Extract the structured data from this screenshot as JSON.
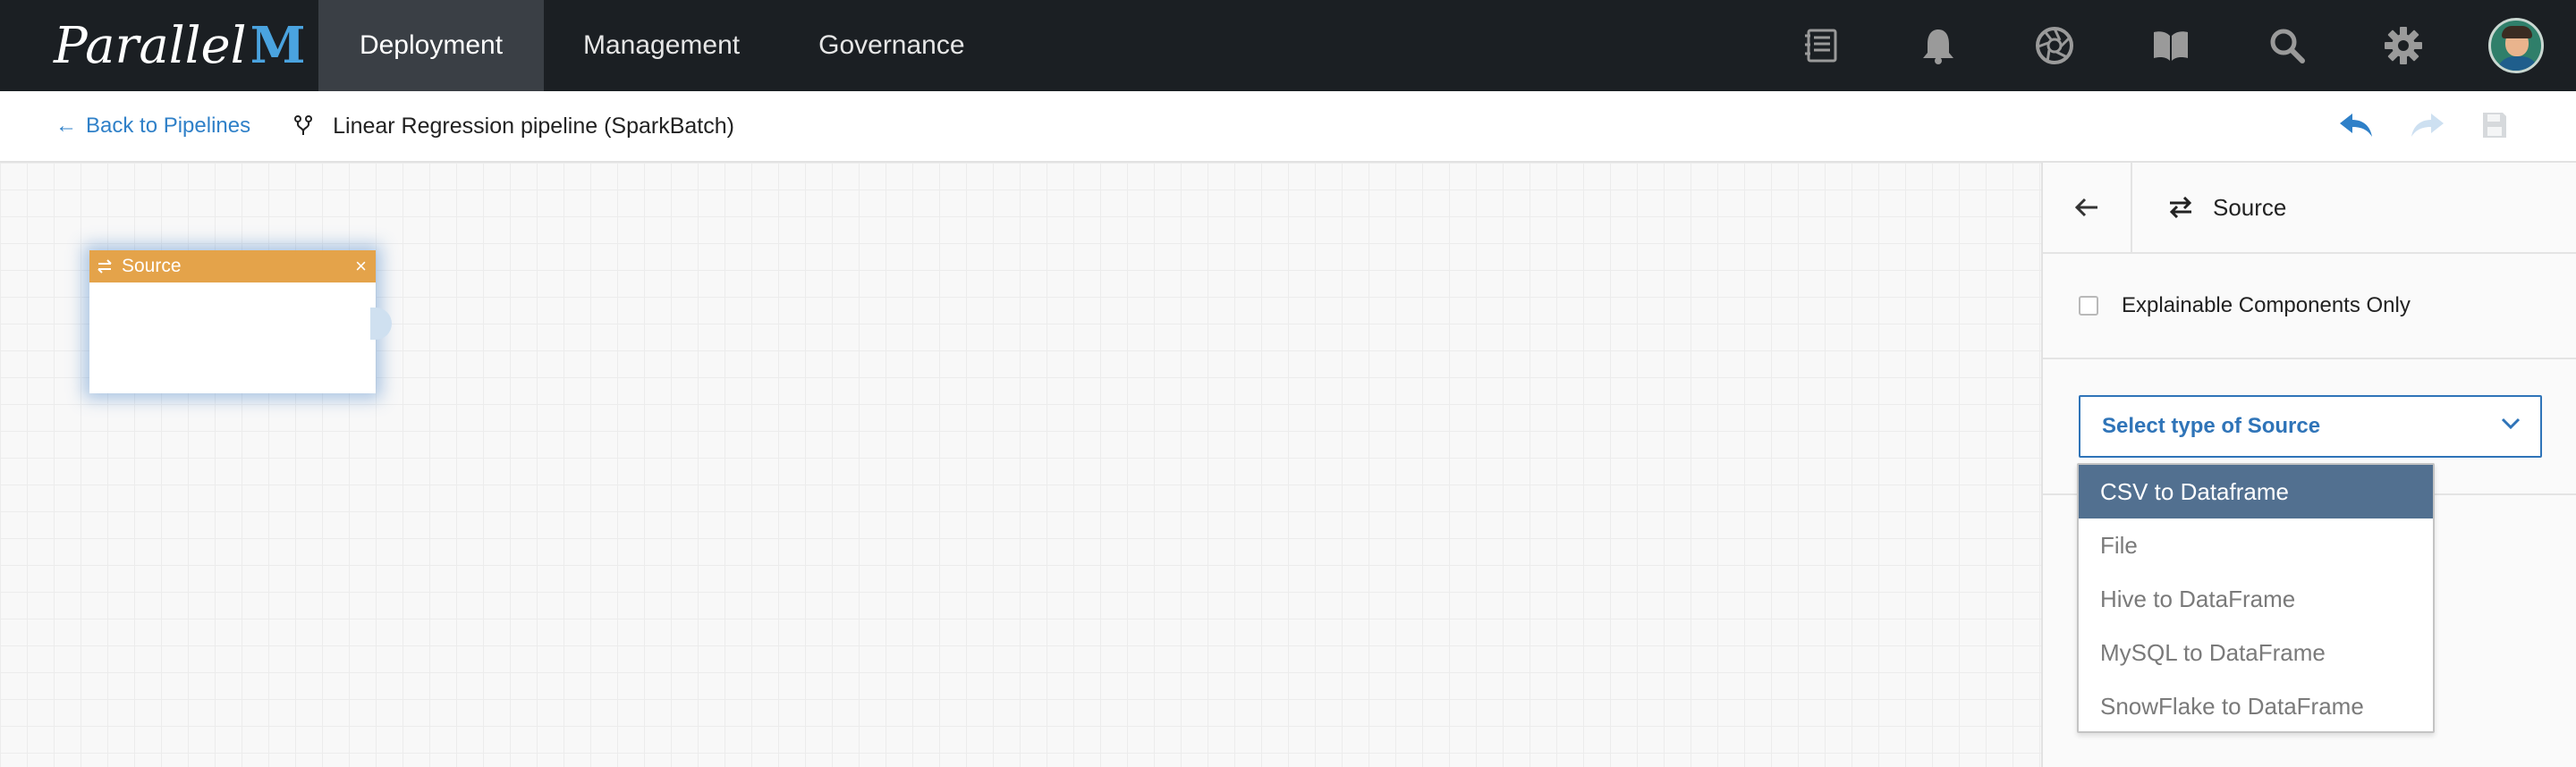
{
  "topbar": {
    "logo_text": "Parallel",
    "logo_accent": "M",
    "tabs": [
      {
        "label": "Deployment",
        "active": true
      },
      {
        "label": "Management",
        "active": false
      },
      {
        "label": "Governance",
        "active": false
      }
    ],
    "icons": [
      "notebook-icon",
      "bell-icon",
      "aperture-icon",
      "book-icon",
      "search-icon",
      "gear-icon",
      "user-avatar"
    ]
  },
  "subheader": {
    "back_label": "Back to Pipelines",
    "pipeline_title": "Linear Regression pipeline (SparkBatch)",
    "actions": [
      "undo-icon",
      "redo-icon",
      "save-icon"
    ]
  },
  "canvas": {
    "node": {
      "title": "Source",
      "icon": "swap-icon",
      "close": "×",
      "header_color": "#e4a34a"
    }
  },
  "panel": {
    "back_icon": "arrow-left-icon",
    "title": "Source",
    "explainable_label": "Explainable Components Only",
    "explainable_checked": false,
    "select_placeholder": "Select type of Source",
    "options": [
      {
        "label": "CSV to Dataframe",
        "selected": true
      },
      {
        "label": "File",
        "selected": false
      },
      {
        "label": "Hive to DataFrame",
        "selected": false
      },
      {
        "label": "MySQL to DataFrame",
        "selected": false
      },
      {
        "label": "SnowFlake to DataFrame",
        "selected": false
      }
    ]
  },
  "colors": {
    "topbar_bg": "#1b1f23",
    "active_tab_bg": "#3a3f45",
    "link_blue": "#2f80c8",
    "node_orange": "#e4a34a",
    "selected_option_bg": "#527090"
  }
}
